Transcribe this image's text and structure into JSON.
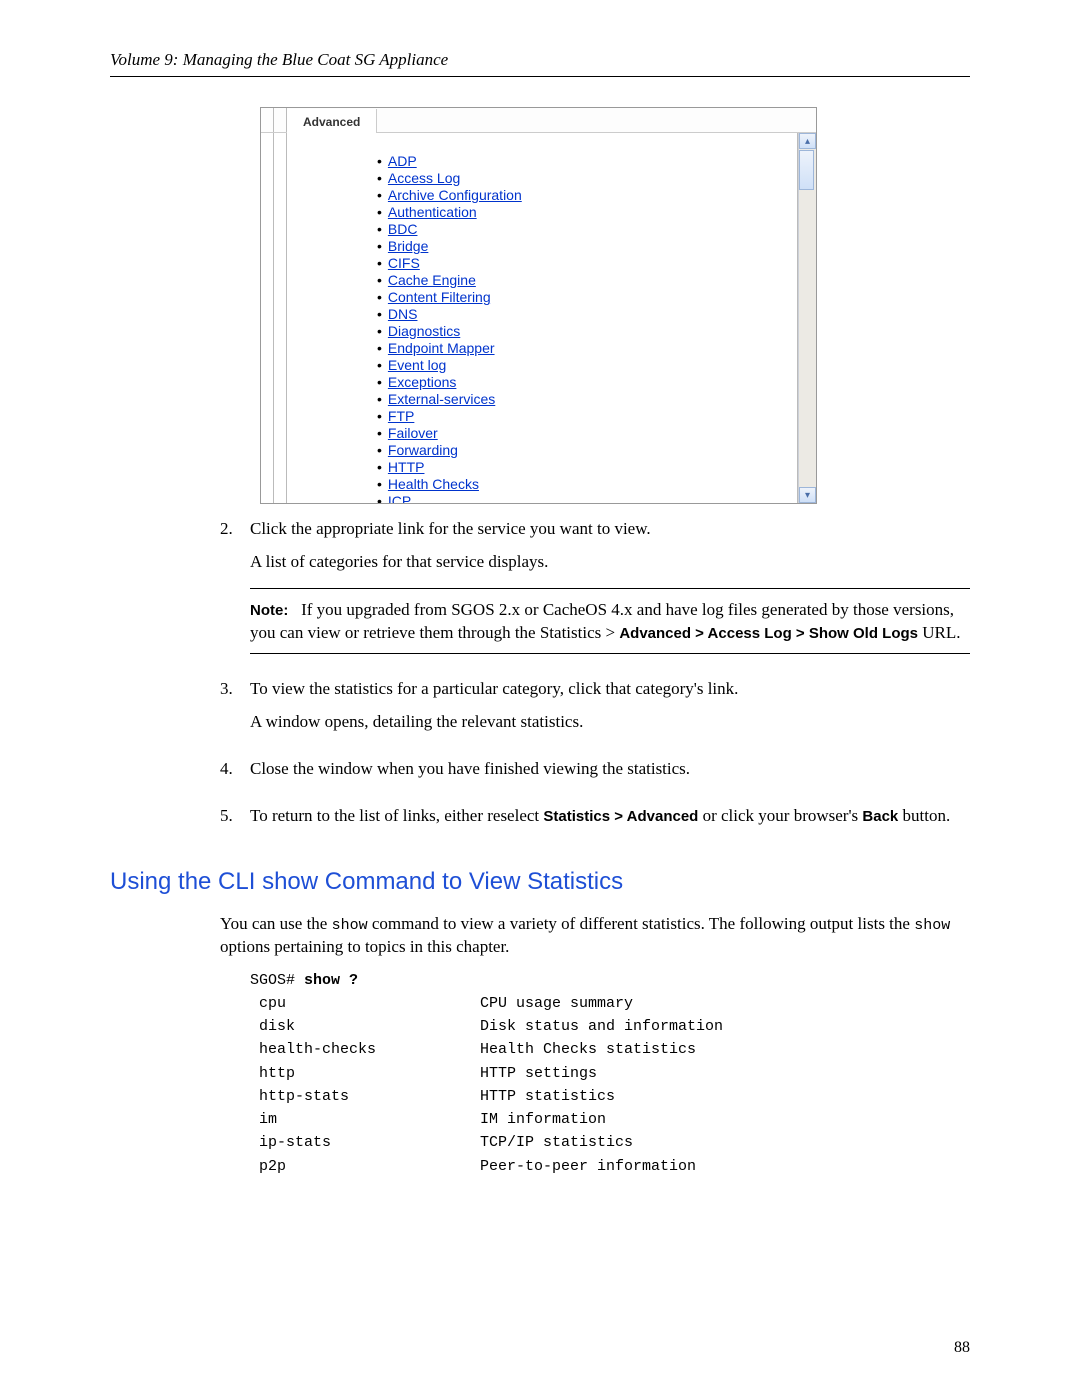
{
  "header": {
    "title": "Volume 9: Managing the Blue Coat SG Appliance"
  },
  "screenshot": {
    "tab_label": "Advanced",
    "links": [
      "ADP",
      "Access Log",
      "Archive Configuration",
      "Authentication",
      "BDC",
      "Bridge",
      "CIFS",
      "Cache Engine",
      "Content Filtering",
      "DNS",
      "Diagnostics",
      "Endpoint Mapper",
      "Event log",
      "Exceptions",
      "External-services",
      "FTP",
      "Failover",
      "Forwarding",
      "HTTP",
      "Health Checks",
      "ICP"
    ],
    "scroll_up": "▴",
    "scroll_down": "▾"
  },
  "steps": {
    "s2": {
      "num": "2.",
      "line1": "Click the appropriate link for the service you want to view.",
      "line2": "A list of categories for that service displays."
    },
    "note": {
      "label": "Note:",
      "text_before": "If you upgraded from SGOS 2.x or CacheOS 4.x and have log files generated by those versions, you can view or retrieve them through the Statistics > ",
      "bold1": "Advanced > Access Log > Show Old Logs",
      "text_after": " URL."
    },
    "s3": {
      "num": "3.",
      "line1": "To view the statistics for a particular category, click that category's link.",
      "line2": "A window opens, detailing the relevant statistics."
    },
    "s4": {
      "num": "4.",
      "line1": "Close the window when you have finished viewing the statistics."
    },
    "s5": {
      "num": "5.",
      "text_before": "To return to the list of links, either reselect ",
      "bold1": "Statistics > Advanced",
      "text_mid": " or click your browser's ",
      "bold2": "Back",
      "text_after": " button."
    }
  },
  "section": {
    "heading": "Using the CLI show Command to View Statistics",
    "intro_before": "You can use the ",
    "intro_code1": "show",
    "intro_mid": " command to view a variety of different statistics. The following output lists the ",
    "intro_code2": "show",
    "intro_after": " options pertaining to topics in this chapter."
  },
  "cli": {
    "prompt_prefix": "SGOS# ",
    "prompt_cmd": "show ?",
    "rows": [
      {
        "opt": " cpu",
        "desc": "CPU usage summary"
      },
      {
        "opt": " disk",
        "desc": "Disk status and information"
      },
      {
        "opt": " health-checks",
        "desc": "Health Checks statistics"
      },
      {
        "opt": " http",
        "desc": "HTTP settings"
      },
      {
        "opt": " http-stats",
        "desc": "HTTP statistics"
      },
      {
        "opt": " im",
        "desc": "IM information"
      },
      {
        "opt": " ip-stats",
        "desc": "TCP/IP statistics"
      },
      {
        "opt": " p2p",
        "desc": "Peer-to-peer information"
      }
    ]
  },
  "page_number": "88"
}
